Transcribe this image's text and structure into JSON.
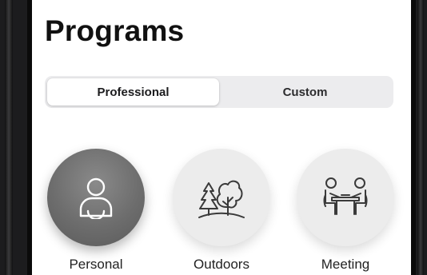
{
  "header": {
    "title": "Programs"
  },
  "segmented_control": {
    "segments": [
      {
        "label": "Professional",
        "selected": true
      },
      {
        "label": "Custom",
        "selected": false
      }
    ]
  },
  "programs": [
    {
      "label": "Personal",
      "icon": "person-icon",
      "selected": true
    },
    {
      "label": "Outdoors",
      "icon": "trees-icon",
      "selected": false
    },
    {
      "label": "Meeting",
      "icon": "meeting-icon",
      "selected": false
    }
  ],
  "colors": {
    "selected_circle": "#6d6d6d",
    "unselected_circle": "#ececec",
    "segment_track": "#ececee",
    "bezel": "#1c1c1e"
  }
}
